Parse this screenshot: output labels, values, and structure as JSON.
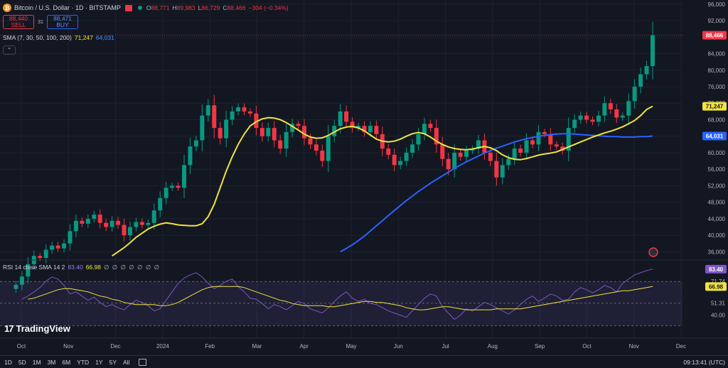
{
  "header": {
    "coin_glyph": "₿",
    "symbol_title": "Bitcoin / U.S. Dollar · 1D · BITSTAMP",
    "ohlc": [
      {
        "k": "O",
        "v": "88,771"
      },
      {
        "k": "H",
        "v": "89,983"
      },
      {
        "k": "L",
        "v": "86,729"
      },
      {
        "k": "C",
        "v": "88,466"
      },
      {
        "k": "",
        "v": "−304 (−0.34%)"
      }
    ]
  },
  "trade": {
    "sell_price": "88,440",
    "sell_label": "SELL",
    "spread": "31",
    "buy_price": "88,471",
    "buy_label": "BUY"
  },
  "sma_legend": {
    "label": "SMA (7, 30, 50, 100, 200)",
    "value_1": "71,247",
    "value_2": "64,031"
  },
  "collapse_glyph": "⌃",
  "rsi_legend": {
    "label": "RSI 14 close SMA 14 2",
    "value_1": "83.40",
    "value_2": "66.98",
    "empty_values": "∅ ∅ ∅ ∅ ∅ ∅ ∅"
  },
  "logo": {
    "mark": "17",
    "text": "TradingView"
  },
  "price_axis": [
    "96,000",
    "92,000",
    "88,000",
    "84,000",
    "80,000",
    "76,000",
    "72,000",
    "68,000",
    "64,000",
    "60,000",
    "56,000",
    "52,000",
    "48,000",
    "44,000",
    "40,000",
    "36,000"
  ],
  "price_badges": {
    "last": "88,466",
    "sma_yellow": "71,247",
    "sma_blue": "64,031"
  },
  "rsi_axis": [
    "71.74",
    "51.31",
    "40.00"
  ],
  "rsi_badges": {
    "rsi": "83.40",
    "sma": "66.98"
  },
  "time_axis": [
    "Oct",
    "Nov",
    "Dec",
    "2024",
    "Feb",
    "Mar",
    "Apr",
    "May",
    "Jun",
    "Jul",
    "Aug",
    "Sep",
    "Oct",
    "Nov",
    "Dec"
  ],
  "ranges": [
    "1D",
    "5D",
    "1M",
    "3M",
    "6M",
    "YTD",
    "1Y",
    "5Y",
    "All"
  ],
  "clock": "09:13:41 (UTC)",
  "colors": {
    "bg": "#131722",
    "up": "#089981",
    "down": "#f23645",
    "sma_yellow": "#f2e33e",
    "sma_blue": "#2962ff",
    "rsi": "#7e57c2"
  },
  "chart_data": {
    "type": "candlestick",
    "price_range": [
      34000,
      97000
    ],
    "x_months": [
      "Oct",
      "Nov",
      "Dec",
      "2024",
      "Feb",
      "Mar",
      "Apr",
      "May",
      "Jun",
      "Jul",
      "Aug",
      "Sep",
      "Oct",
      "Nov",
      "Dec"
    ],
    "close_path": [
      27000,
      28000,
      30000,
      33000,
      35000,
      34500,
      36500,
      37500,
      36800,
      38000,
      41000,
      43500,
      42800,
      44000,
      45000,
      43000,
      42000,
      43500,
      42500,
      40000,
      42000,
      43200,
      42500,
      43000,
      46000,
      49000,
      51500,
      52000,
      51500,
      57000,
      61500,
      63000,
      69000,
      71500,
      66000,
      63500,
      68000,
      70000,
      71000,
      70000,
      69500,
      66000,
      64000,
      66000,
      63000,
      61000,
      65000,
      67000,
      66500,
      63500,
      62000,
      60500,
      58000,
      64000,
      66500,
      70000,
      67500,
      66000,
      66500,
      65000,
      66500,
      64500,
      61000,
      59500,
      57000,
      58000,
      60000,
      62000,
      64500,
      67000,
      66000,
      62000,
      58500,
      56000,
      60000,
      59000,
      60500,
      61000,
      63000,
      60000,
      58000,
      54000,
      57000,
      58500,
      61000,
      60000,
      63000,
      62000,
      65000,
      64500,
      62000,
      61500,
      60500,
      66000,
      68000,
      69000,
      68000,
      67500,
      69000,
      72000,
      70500,
      68500,
      69000,
      72500,
      76000,
      79000,
      81000,
      88466
    ],
    "sma_yellow": [
      null,
      null,
      null,
      null,
      null,
      null,
      null,
      null,
      null,
      null,
      35000,
      36000,
      37000,
      38200,
      39500,
      40500,
      41500,
      42200,
      42700,
      43000,
      42800,
      42500,
      42400,
      42300,
      42300,
      42800,
      44500,
      47500,
      51500,
      55500,
      59000,
      62000,
      64500,
      66500,
      67500,
      68200,
      68500,
      68400,
      68000,
      67300,
      66400,
      65500,
      64500,
      63800,
      63500,
      63600,
      64200,
      65000,
      65800,
      66200,
      66400,
      66000,
      65300,
      64300,
      63300,
      62800,
      62600,
      62800,
      63300,
      64000,
      64600,
      64900,
      64600,
      63800,
      62800,
      62000,
      61400,
      61000,
      60800,
      60700,
      60900,
      61200,
      61500,
      61200,
      60500,
      59500,
      58800,
      58400,
      58300,
      58600,
      59000,
      59400,
      59700,
      59900,
      60200,
      60800,
      61400,
      62000,
      62600,
      63200,
      63800,
      64300,
      64800,
      65200,
      65700,
      66300,
      67000,
      67800,
      69000,
      70500,
      71247
    ],
    "sma_blue": [
      null,
      null,
      null,
      null,
      null,
      null,
      null,
      null,
      null,
      null,
      null,
      null,
      null,
      null,
      null,
      null,
      null,
      null,
      null,
      null,
      null,
      null,
      null,
      null,
      null,
      null,
      null,
      null,
      null,
      null,
      null,
      null,
      null,
      null,
      null,
      36000,
      36800,
      37700,
      38700,
      39800,
      41000,
      42300,
      43500,
      44800,
      46000,
      47200,
      48400,
      49500,
      50600,
      51600,
      52600,
      53500,
      54400,
      55300,
      56200,
      57000,
      57800,
      58500,
      59200,
      59900,
      60500,
      61100,
      61600,
      62100,
      62600,
      63000,
      63400,
      63700,
      64000,
      64200,
      64400,
      64500,
      64600,
      64600,
      64500,
      64400,
      64300,
      64200,
      64100,
      64000,
      63900,
      63900,
      63800,
      63800,
      63800,
      63900,
      63900,
      64031
    ],
    "rsi": [
      55,
      58,
      62,
      66,
      72,
      76,
      74,
      68,
      60,
      62,
      58,
      54,
      57,
      52,
      48,
      50,
      47,
      45,
      50,
      54,
      52,
      49,
      44,
      46,
      54,
      62,
      70,
      75,
      78,
      80,
      76,
      70,
      65,
      68,
      72,
      74,
      67,
      62,
      56,
      55,
      51,
      46,
      50,
      48,
      45,
      49,
      53,
      51,
      46,
      44,
      42,
      47,
      53,
      58,
      62,
      56,
      53,
      55,
      51,
      50,
      47,
      44,
      42,
      40,
      38,
      44,
      50,
      56,
      60,
      58,
      48,
      42,
      36,
      40,
      46,
      44,
      48,
      52,
      50,
      47,
      44,
      41,
      45,
      50,
      55,
      58,
      53,
      56,
      60,
      58,
      54,
      55,
      62,
      66,
      64,
      61,
      64,
      68,
      66,
      62,
      70,
      74,
      78,
      80,
      82,
      83.4
    ],
    "rsi_sma": [
      55,
      56,
      58,
      60,
      62,
      64,
      65,
      65,
      64,
      63,
      62,
      60,
      58,
      57,
      55,
      54,
      52,
      51,
      50,
      50,
      50,
      50,
      49,
      49,
      50,
      52,
      55,
      58,
      61,
      64,
      66,
      67,
      67,
      67,
      67,
      67,
      66,
      64,
      62,
      60,
      58,
      56,
      54,
      53,
      51,
      50,
      49,
      49,
      49,
      49,
      48,
      48,
      49,
      50,
      51,
      52,
      53,
      53,
      52,
      52,
      51,
      50,
      49,
      47,
      46,
      45,
      45,
      46,
      47,
      48,
      48,
      47,
      46,
      45,
      45,
      45,
      45,
      45,
      46,
      46,
      46,
      46,
      46,
      47,
      48,
      49,
      50,
      51,
      52,
      53,
      54,
      55,
      56,
      57,
      58,
      59,
      60,
      61,
      62,
      63,
      63,
      64,
      65,
      66,
      66.98
    ],
    "rsi_levels": [
      71.74,
      51.31,
      40
    ]
  }
}
